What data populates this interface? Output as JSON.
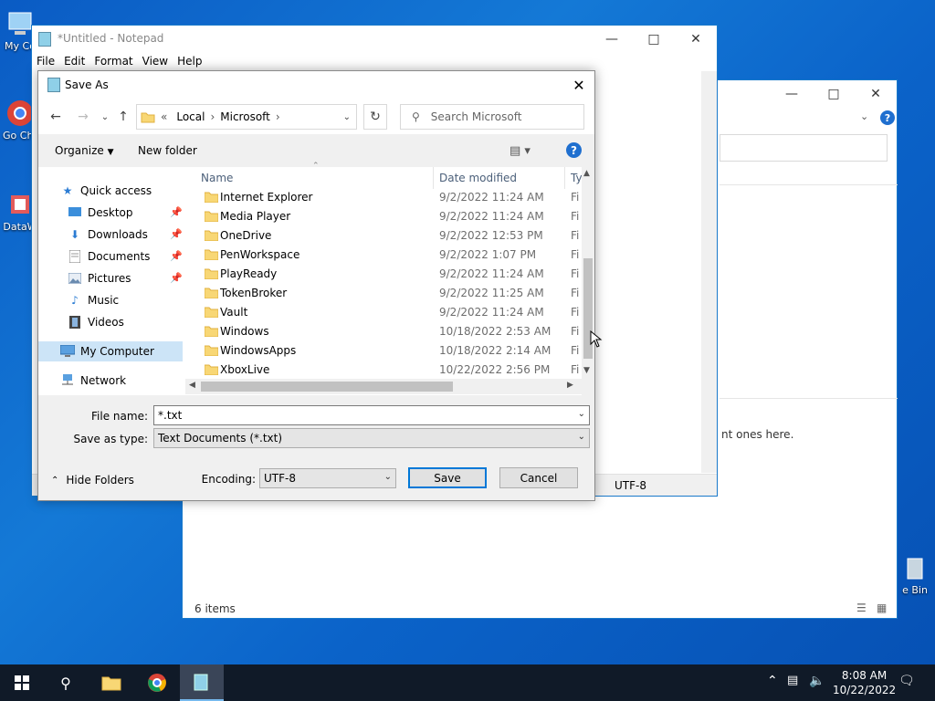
{
  "desktop": {
    "icons": [
      {
        "label": "My Co"
      },
      {
        "label": "Go Chr"
      },
      {
        "label": "DataW"
      }
    ],
    "recycle_label": "e Bin"
  },
  "explorer": {
    "empty_message": "nt ones here.",
    "status": "6 items"
  },
  "notepad": {
    "title": "*Untitled - Notepad",
    "menu": [
      "File",
      "Edit",
      "Format",
      "View",
      "Help"
    ],
    "encoding": "UTF-8"
  },
  "dialog": {
    "title": "Save As",
    "breadcrumb": {
      "prefix": "«",
      "parts": [
        "Local",
        "Microsoft"
      ]
    },
    "search_placeholder": "Search Microsoft",
    "toolbar": {
      "organize": "Organize",
      "new_folder": "New folder"
    },
    "nav": [
      {
        "label": "Quick access"
      },
      {
        "label": "Desktop"
      },
      {
        "label": "Downloads"
      },
      {
        "label": "Documents"
      },
      {
        "label": "Pictures"
      },
      {
        "label": "Music"
      },
      {
        "label": "Videos"
      },
      {
        "label": "My Computer"
      },
      {
        "label": "Network"
      }
    ],
    "columns": {
      "name": "Name",
      "date": "Date modified",
      "type": "Ty"
    },
    "files": [
      {
        "name": "Internet Explorer",
        "date": "9/2/2022 11:24 AM",
        "type": "Fi"
      },
      {
        "name": "Media Player",
        "date": "9/2/2022 11:24 AM",
        "type": "Fi"
      },
      {
        "name": "OneDrive",
        "date": "9/2/2022 12:53 PM",
        "type": "Fi"
      },
      {
        "name": "PenWorkspace",
        "date": "9/2/2022 1:07 PM",
        "type": "Fi"
      },
      {
        "name": "PlayReady",
        "date": "9/2/2022 11:24 AM",
        "type": "Fi"
      },
      {
        "name": "TokenBroker",
        "date": "9/2/2022 11:25 AM",
        "type": "Fi"
      },
      {
        "name": "Vault",
        "date": "9/2/2022 11:24 AM",
        "type": "Fi"
      },
      {
        "name": "Windows",
        "date": "10/18/2022 2:53 AM",
        "type": "Fi"
      },
      {
        "name": "WindowsApps",
        "date": "10/18/2022 2:14 AM",
        "type": "Fi"
      },
      {
        "name": "XboxLive",
        "date": "10/22/2022 2:56 PM",
        "type": "Fi"
      }
    ],
    "file_name_label": "File name:",
    "file_name_value": "*.txt",
    "save_type_label": "Save as type:",
    "save_type_value": "Text Documents (*.txt)",
    "encoding_label": "Encoding:",
    "encoding_value": "UTF-8",
    "save": "Save",
    "cancel": "Cancel",
    "hide_folders": "Hide Folders"
  },
  "taskbar": {
    "time": "8:08 AM",
    "date": "10/22/2022"
  }
}
